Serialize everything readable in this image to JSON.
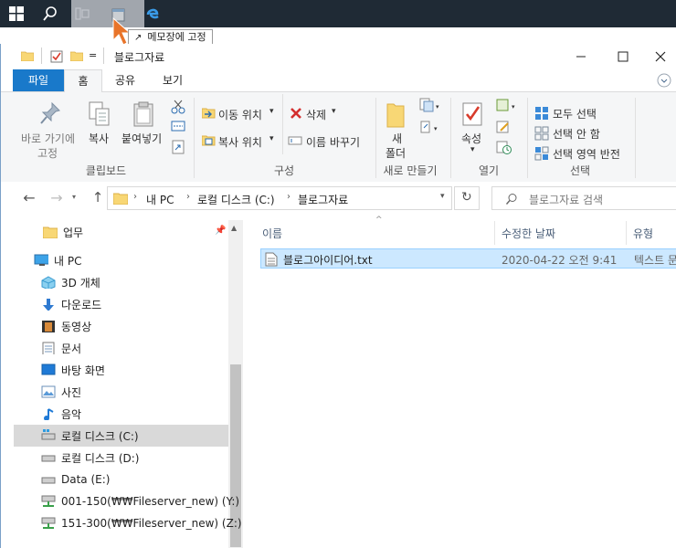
{
  "taskbar": {
    "tooltip": "메모장에 고정"
  },
  "window": {
    "title": "블로그자료",
    "quick_access_symbol": "="
  },
  "ribbon_tabs": [
    "파일",
    "홈",
    "공유",
    "보기"
  ],
  "ribbon": {
    "pin_label_1": "바로 가기에",
    "pin_label_2": "고정",
    "copy_label": "복사",
    "paste_label": "붙여넣기",
    "clipboard_group": "클립보드",
    "move_to": "이동 위치",
    "copy_to": "복사 위치",
    "delete": "삭제",
    "rename": "이름 바꾸기",
    "organize_group": "구성",
    "new_folder_1": "새",
    "new_folder_2": "폴더",
    "new_group": "새로 만들기",
    "properties": "속성",
    "open_group": "열기",
    "select_all": "모두 선택",
    "select_none": "선택 안 함",
    "invert_selection": "선택 영역 반전",
    "select_group": "선택"
  },
  "address": {
    "crumbs": [
      "내 PC",
      "로컬 디스크 (C:)",
      "블로그자료"
    ],
    "search_placeholder": "블로그자료 검색"
  },
  "nav": {
    "items": [
      {
        "label": "업무",
        "icon": "folder-icon"
      },
      {
        "label": "내 PC",
        "icon": "computer-icon"
      },
      {
        "label": "3D 개체",
        "icon": "cube-3d-icon"
      },
      {
        "label": "다운로드",
        "icon": "download-arrow-icon"
      },
      {
        "label": "동영상",
        "icon": "film-icon"
      },
      {
        "label": "문서",
        "icon": "document-icon"
      },
      {
        "label": "바탕 화면",
        "icon": "desktop-icon"
      },
      {
        "label": "사진",
        "icon": "picture-icon"
      },
      {
        "label": "음악",
        "icon": "music-note-icon"
      },
      {
        "label": "로컬 디스크 (C:)",
        "icon": "drive-icon"
      },
      {
        "label": "로컬 디스크 (D:)",
        "icon": "drive-icon"
      },
      {
        "label": "Data (E:)",
        "icon": "drive-icon"
      },
      {
        "label": "001-150(₩₩Fileserver_new) (Y:)",
        "icon": "network-drive-icon"
      },
      {
        "label": "151-300(₩₩Fileserver_new) (Z:)",
        "icon": "network-drive-icon"
      }
    ]
  },
  "columns": [
    "이름",
    "수정한 날짜",
    "유형"
  ],
  "files": [
    {
      "name": "블로그아이디어.txt",
      "modified": "2020-04-22 오전 9:41",
      "type": "텍스트 문"
    }
  ],
  "colors": {
    "accent": "#1979ca",
    "selected": "#cce8ff",
    "taskbar": "#1f2a35",
    "cursor": "#e8742a"
  }
}
